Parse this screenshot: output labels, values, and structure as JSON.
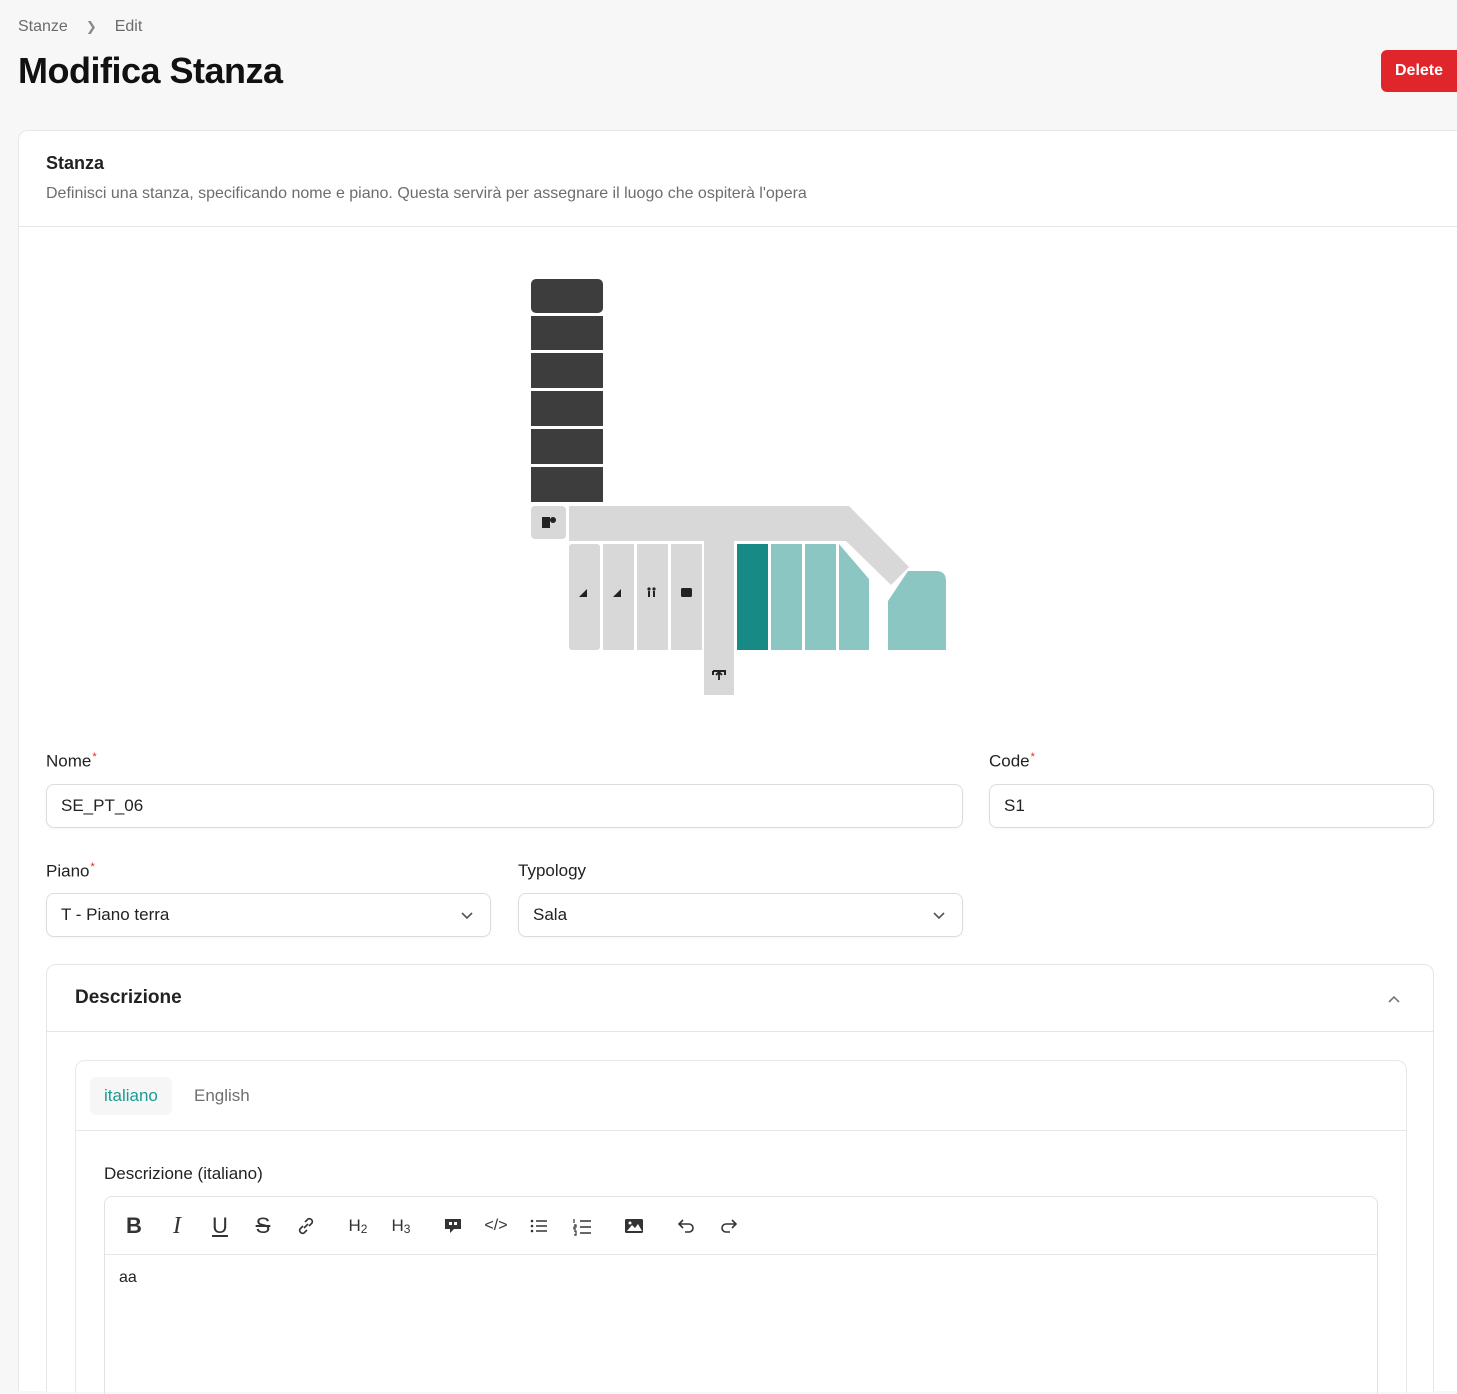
{
  "breadcrumb": {
    "items": [
      "Stanze",
      "Edit"
    ]
  },
  "page": {
    "title": "Modifica Stanza",
    "delete_label": "Delete"
  },
  "card": {
    "title": "Stanza",
    "description": "Definisci una stanza, specificando nome e piano. Questa servirà per assegnare il luogo che ospiterà l'opera"
  },
  "form": {
    "nome": {
      "label": "Nome",
      "value": "SE_PT_06"
    },
    "code": {
      "label": "Code",
      "value": "S1"
    },
    "piano": {
      "label": "Piano",
      "value": "T - Piano terra"
    },
    "typology": {
      "label": "Typology",
      "value": "Sala"
    }
  },
  "descrizione": {
    "title": "Descrizione",
    "tabs": [
      "italiano",
      "English"
    ],
    "active_tab": "italiano",
    "editor_label": "Descrizione (italiano)",
    "content": "aa",
    "toolbar": [
      "bold-icon",
      "italic-icon",
      "underline-icon",
      "strikethrough-icon",
      "link-icon",
      "heading2-icon",
      "heading3-icon",
      "blockquote-icon",
      "code-icon",
      "bullet-list-icon",
      "ordered-list-icon",
      "image-icon",
      "undo-icon",
      "redo-icon"
    ]
  },
  "colors": {
    "accent": "#1a9a92",
    "danger": "#e0262a",
    "room_dark": "#3d3d3d",
    "room_selected": "#188a86",
    "room_highlight": "#8cc6c2",
    "room_default": "#d8d8d8"
  }
}
